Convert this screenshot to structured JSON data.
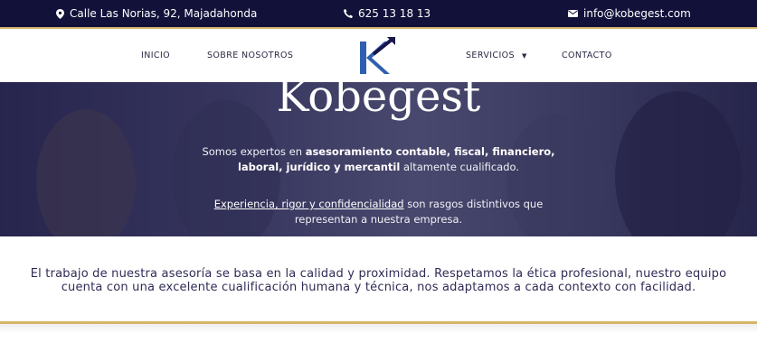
{
  "topbar": {
    "address": "Calle Las Norias, 92, Majadahonda",
    "phone": "625 13 18 13",
    "email": "info@kobegest.com",
    "icons": [
      "location-pin-icon",
      "phone-icon",
      "envelope-icon"
    ]
  },
  "nav": {
    "inicio": "INICIO",
    "sobre": "SOBRE NOSOTROS",
    "servicios": "SERVICIOS",
    "contacto": "CONTACTO",
    "logo_text": "K"
  },
  "hero": {
    "title": "Kobegest",
    "line1_a": "Somos expertos en ",
    "line1_b": "asesoramiento contable, fiscal, financiero,",
    "line2_a": "laboral, jurídico y mercantil",
    "line2_b": " altamente cualificado.",
    "line3_a": "Experiencia, rigor y confidencialidad",
    "line3_b": " son rasgos distintivos que",
    "line4": "representan a nuestra empresa."
  },
  "description": {
    "line1": "El trabajo de nuestra asesoría se basa en la calidad y proximidad. Respetamos la ética profesional, nuestro equipo",
    "line2": "cuenta con una excelente cualificación humana y técnica, nos adaptamos a cada contexto con facilidad."
  },
  "colors": {
    "navy": "#12113a",
    "gold": "#d6b469",
    "logo_blue": "#2f5fb0"
  }
}
